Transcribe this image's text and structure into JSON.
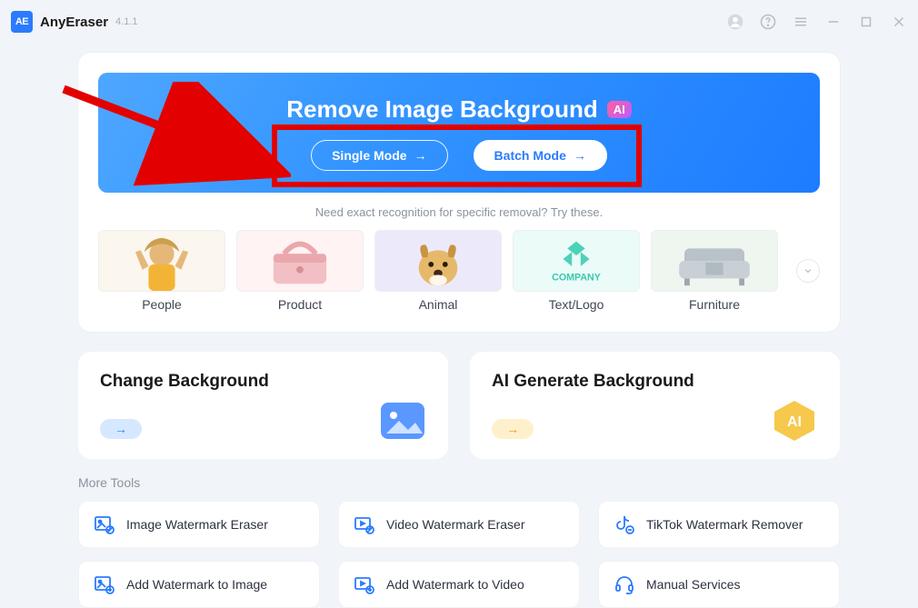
{
  "app": {
    "logo_text": "AE",
    "name": "AnyEraser",
    "version": "4.1.1"
  },
  "hero": {
    "title": "Remove Image Background",
    "ai_badge": "AI",
    "single_mode": "Single Mode",
    "batch_mode": "Batch Mode",
    "hint": "Need exact recognition for specific removal? Try these."
  },
  "categories": [
    {
      "label": "People"
    },
    {
      "label": "Product"
    },
    {
      "label": "Animal"
    },
    {
      "label": "Text/Logo",
      "demo_text": "COMPANY"
    },
    {
      "label": "Furniture"
    }
  ],
  "subcards": {
    "change_bg": {
      "title": "Change Background"
    },
    "ai_gen_bg": {
      "title": "AI Generate Background",
      "icon_text": "AI"
    }
  },
  "more_tools": {
    "heading": "More Tools",
    "row1": [
      {
        "label": "Image Watermark Eraser"
      },
      {
        "label": "Video Watermark Eraser"
      },
      {
        "label": "TikTok Watermark Remover"
      }
    ],
    "row2": [
      {
        "label": "Add Watermark to Image"
      },
      {
        "label": "Add Watermark to Video"
      },
      {
        "label": "Manual Services"
      }
    ]
  }
}
